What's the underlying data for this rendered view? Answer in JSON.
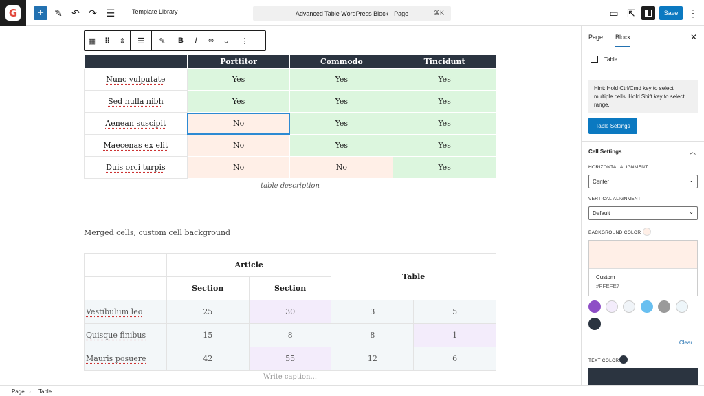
{
  "topbar": {
    "logo_letter": "G",
    "add_icon": "plus-icon",
    "template_label": "Template Library",
    "doc_title": "Advanced Table WordPress Block · Page",
    "shortcut": "⌘K",
    "save_label": "Save"
  },
  "table1": {
    "headers": [
      "",
      "Porttitor",
      "Commodo",
      "Tincidunt"
    ],
    "rows": [
      {
        "label": "Nunc vulputate",
        "cells": [
          "Yes",
          "Yes",
          "Yes"
        ]
      },
      {
        "label": "Sed nulla nibh",
        "cells": [
          "Yes",
          "Yes",
          "Yes"
        ]
      },
      {
        "label": "Aenean suscipit",
        "cells": [
          "No",
          "Yes",
          "Yes"
        ]
      },
      {
        "label": "Maecenas ex elit",
        "cells": [
          "No",
          "Yes",
          "Yes"
        ]
      },
      {
        "label": "Duis orci turpis",
        "cells": [
          "No",
          "No",
          "Yes"
        ]
      }
    ],
    "description": "table description"
  },
  "section_label": "Merged cells, custom cell background",
  "table2": {
    "header_article": "Article",
    "header_table": "Table",
    "header_section1": "Section",
    "header_section2": "Section",
    "rows": [
      {
        "label": "Vestibulum leo",
        "cells": [
          "25",
          "30",
          "3",
          "5"
        ]
      },
      {
        "label": "Quisque finibus",
        "cells": [
          "15",
          "8",
          "8",
          "1"
        ]
      },
      {
        "label": "Mauris posuere",
        "cells": [
          "42",
          "55",
          "12",
          "6"
        ]
      }
    ],
    "caption": "Write caption..."
  },
  "sidebar": {
    "tab_page": "Page",
    "tab_block": "Block",
    "block_name": "Table",
    "hint": "Hint: Hold Ctrl/Cmd key to select multiple cells. Hold Shift key to select range.",
    "table_settings_label": "Table Settings",
    "cell_settings_title": "Cell Settings",
    "horizontal_label": "HORIZONTAL ALIGNMENT",
    "horizontal_value": "Center",
    "vertical_label": "VERTICAL ALIGNMENT",
    "vertical_value": "Default",
    "bg_label": "BACKGROUND COLOR",
    "custom_label": "Custom",
    "custom_hex": "#FFEFE7",
    "clear_label": "Clear",
    "text_color_label": "TEXT COLOR",
    "palette_colors": [
      "#8e4ec6",
      "#f3ecfb",
      "#f0f4f8",
      "#68bff0",
      "#9a9a9a",
      "#eef6fa",
      "#2b3440"
    ]
  },
  "footer": {
    "crumb1": "Page",
    "crumb2": "Table"
  },
  "colors": {
    "accent": "#2271b1",
    "header_dark": "#2b3440",
    "green_cell": "#dcf6de",
    "pink_cell": "#ffefe7"
  }
}
